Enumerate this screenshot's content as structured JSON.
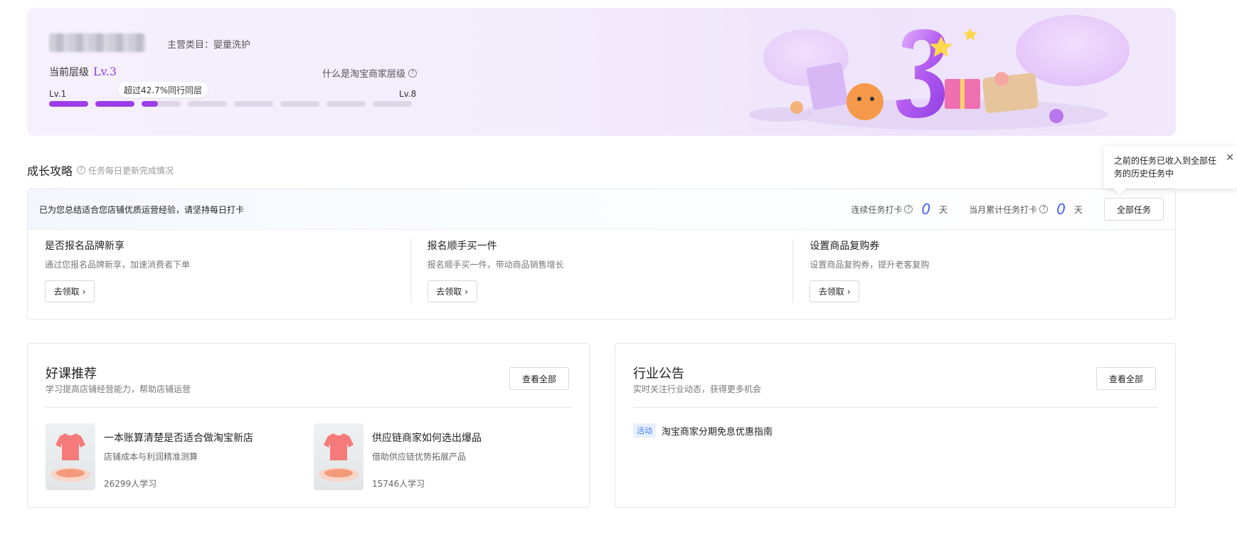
{
  "banner": {
    "main_category": "主营类目：婴童洗护",
    "level_label": "当前层级",
    "level_value": "Lv.3",
    "level_help": "什么是淘宝商家层级",
    "peer_tooltip": "超过42.7%同行同层",
    "lv_min": "Lv.1",
    "lv_max": "Lv.8",
    "progress": {
      "total_segments": 8,
      "completed_segments": 2,
      "current_segment_fill": 0.42
    },
    "accent_color": "#9b3ee8"
  },
  "growth": {
    "title": "成长攻略",
    "subtitle": "任务每日更新完成情况",
    "tip": "已为您总结适合您店铺优质运营经验，请坚持每日打卡",
    "streak_label": "连续任务打卡",
    "streak_value": "0",
    "monthly_label": "当月累计任务打卡",
    "monthly_value": "0",
    "day_unit": "天",
    "all_tasks_label": "全部任务",
    "tasks": [
      {
        "title": "是否报名品牌新享",
        "desc": "通过您报名品牌新享，加速消费者下单",
        "action": "去领取"
      },
      {
        "title": "报名顺手买一件",
        "desc": "报名顺手买一件，带动商品销售增长",
        "action": "去领取"
      },
      {
        "title": "设置商品复购券",
        "desc": "设置商品复购券，提升老客复购",
        "action": "去领取"
      }
    ]
  },
  "popover": {
    "text": "之前的任务已收入到全部任务的历史任务中",
    "close_icon": "close-icon"
  },
  "courses": {
    "title": "好课推荐",
    "subtitle": "学习提高店铺经营能力，帮助店铺运营",
    "view_all": "查看全部",
    "items": [
      {
        "title": "一本账算清楚是否适合做淘宝新店",
        "desc": "店铺成本与利润精准测算",
        "learners": "26299人学习"
      },
      {
        "title": "供应链商家如何选出爆品",
        "desc": "借助供应链优势拓展产品",
        "learners": "15746人学习"
      }
    ]
  },
  "notices": {
    "title": "行业公告",
    "subtitle": "实时关注行业动态，获得更多机会",
    "view_all": "查看全部",
    "items": [
      {
        "tag": "活动",
        "text": "淘宝商家分期免息优惠指南"
      }
    ]
  }
}
